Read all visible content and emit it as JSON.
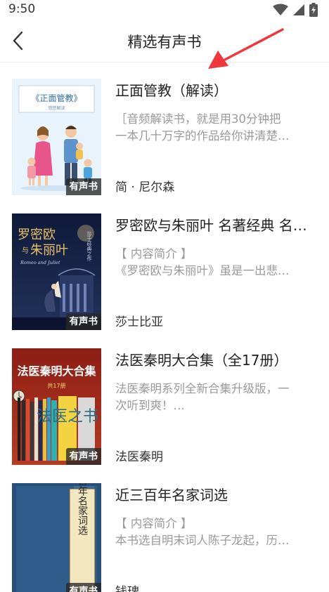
{
  "status_bar": {
    "time": "9:50"
  },
  "nav": {
    "title": "精选有声书"
  },
  "badge_label": "有声书",
  "books": [
    {
      "title": "正面管教（解读）",
      "desc_line1": "［音频解读书，就是用30分钟把",
      "desc_line2": "一本几十万字的作品给你讲清楚…",
      "author": "简 · 尼尔森",
      "cover_title": "《正面管教》",
      "cover_subtitle": "悠悠解读"
    },
    {
      "title": "罗密欧与朱丽叶 名著经典 名…",
      "desc_line1": "【 内容简介 】",
      "desc_line2": "《罗密欧与朱丽叶》虽是一出悲…",
      "author": "莎士比亚",
      "cover_title_1": "罗密欧",
      "cover_title_2": "朱丽叶",
      "cover_yu": "与",
      "cover_en": "Romeo and Juliet",
      "cover_side": "莎士经典之作"
    },
    {
      "title": "法医秦明大合集（全17册）",
      "desc_line1": "法医秦明系列全新合集升级版，一",
      "desc_line2": "次听到爽！…",
      "author": "法医秦明",
      "cover_title": "法医秦明大合集",
      "cover_subtitle": "共17册",
      "cover_big": "法医之书"
    },
    {
      "title": "近三百年名家词选",
      "desc_line1": "【 内容简介 】",
      "desc_line2": "本书选自明末词人陈子龙起，历…",
      "author": "钱琕",
      "cover_title": "近三百年名家词选"
    }
  ]
}
